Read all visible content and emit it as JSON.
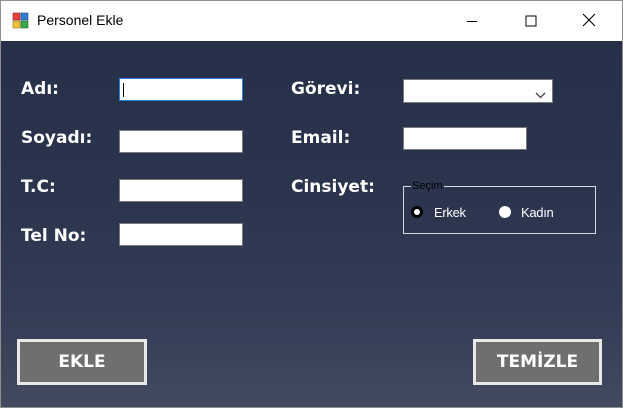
{
  "window": {
    "title": "Personel Ekle"
  },
  "form": {
    "labels": {
      "adi": "Adı:",
      "soyadi": "Soyadı:",
      "tc": "T.C:",
      "tel": "Tel No:",
      "gorevi": "Görevi:",
      "email": "Email:",
      "cinsiyet": "Cinsiyet:"
    },
    "values": {
      "adi": "",
      "soyadi": "",
      "tc": "",
      "tel": "",
      "gorevi": "",
      "email": ""
    },
    "gender": {
      "group_title": "Seçim",
      "options": [
        "Erkek",
        "Kadın"
      ],
      "selected": "Erkek"
    }
  },
  "buttons": {
    "add": "EKLE",
    "clear": "TEMİZLE"
  },
  "icons": {
    "app": "app-form-icon",
    "minimize": "minimize-icon",
    "maximize": "maximize-icon",
    "close": "close-icon",
    "dropdown": "chevron-down-icon"
  },
  "colors": {
    "background_top": "#273049",
    "background_bottom": "#424a60",
    "button_fill": "#6f6f6f",
    "button_border": "#e8e8e8",
    "focus_border": "#2f7dd6"
  }
}
